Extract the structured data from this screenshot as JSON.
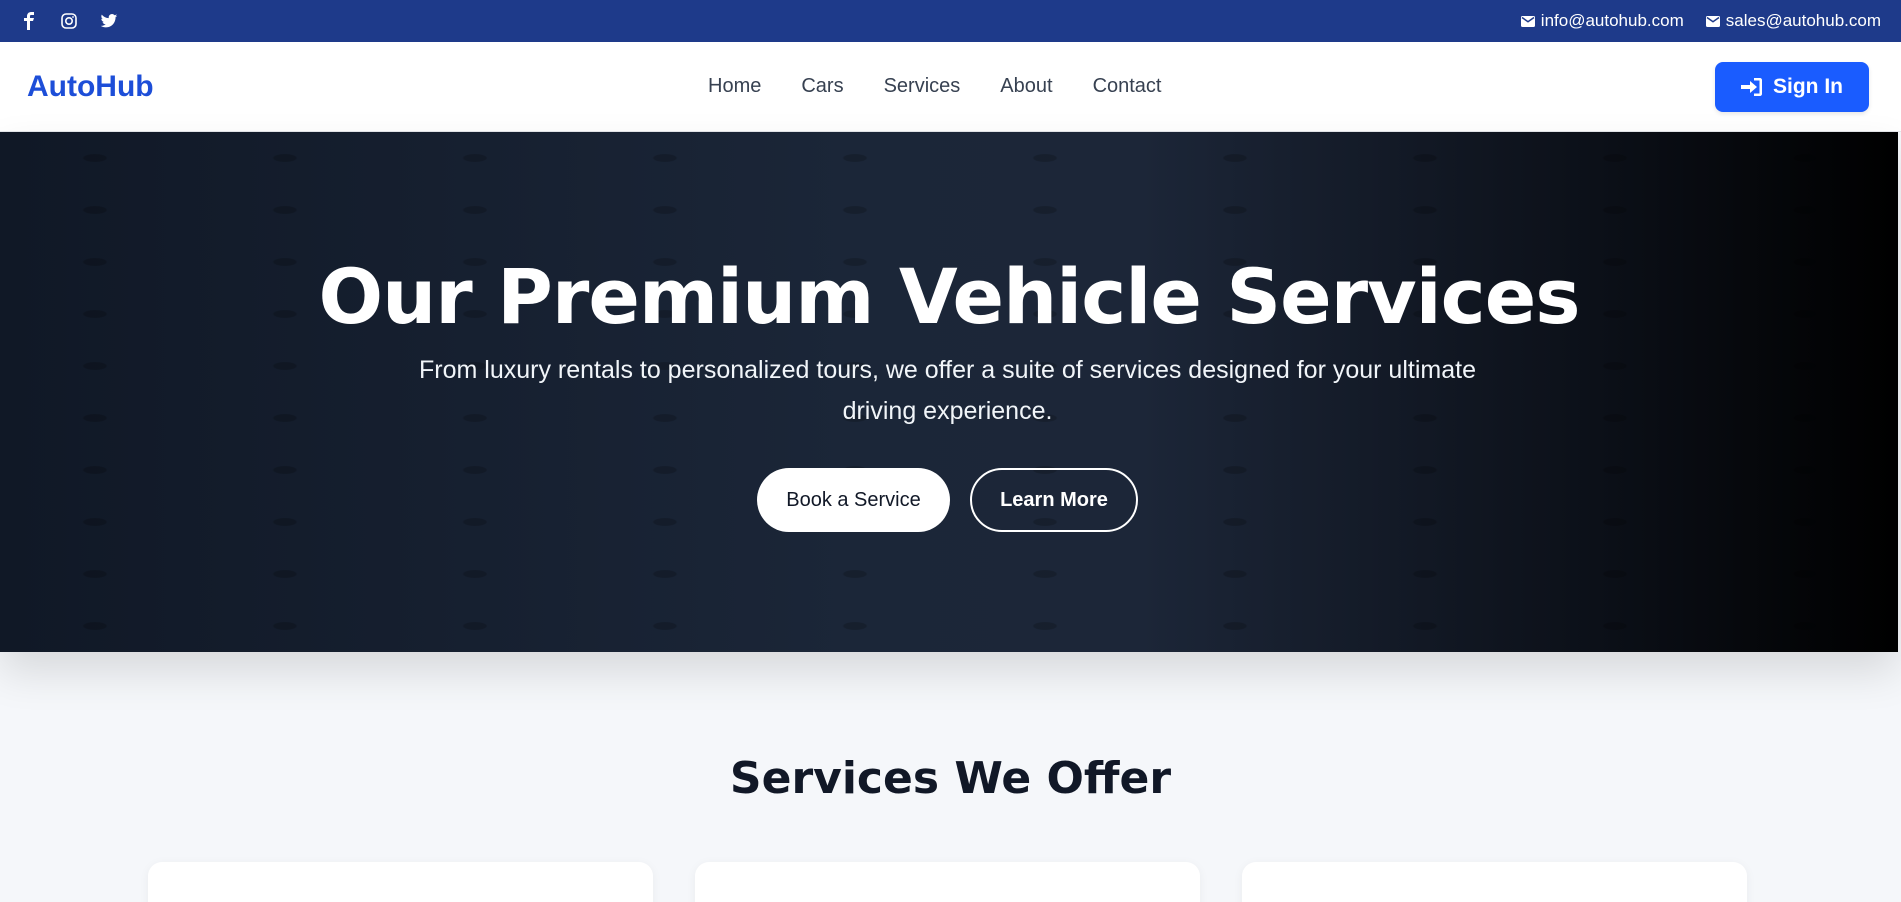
{
  "topbar": {
    "social": [
      {
        "icon": "facebook-icon"
      },
      {
        "icon": "instagram-icon"
      },
      {
        "icon": "twitter-icon"
      }
    ],
    "emails": [
      "info@autohub.com",
      "sales@autohub.com"
    ]
  },
  "navbar": {
    "brand": "AutoHub",
    "links": [
      "Home",
      "Cars",
      "Services",
      "About",
      "Contact"
    ],
    "signin_label": "Sign In"
  },
  "hero": {
    "title": "Our Premium Vehicle Services",
    "subtitle": "From luxury rentals to personalized tours, we offer a suite of services designed for your ultimate driving experience.",
    "primary_cta": "Book a Service",
    "secondary_cta": "Learn More"
  },
  "services": {
    "heading": "Services We Offer"
  },
  "colors": {
    "topbar": "#1e3a8a",
    "brand": "#1d4ed8",
    "signin": "#1a5cff"
  }
}
